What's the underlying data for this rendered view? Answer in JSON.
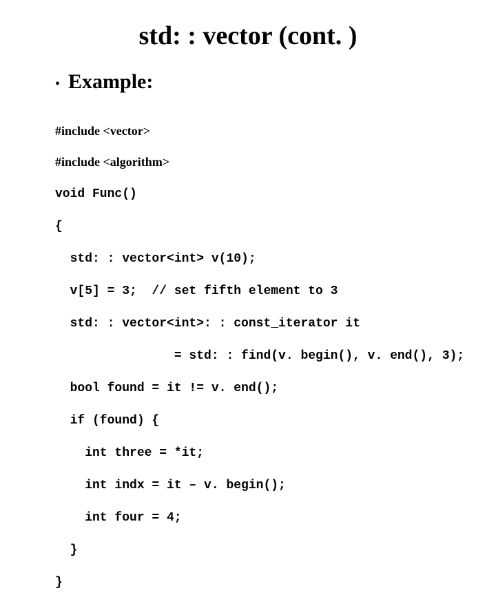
{
  "slide": {
    "title": "std: : vector (cont. )",
    "bullet": "Example:",
    "code": {
      "l1": "#include <vector>",
      "l2": "#include <algorithm>",
      "l3": "void Func()",
      "l4": "{",
      "l5": "  std: : vector<int> v(10);",
      "l6": "  v[5] = 3;  // set fifth element to 3",
      "l7": "  std: : vector<int>: : const_iterator it",
      "l8": "                = std: : find(v. begin(), v. end(), 3);",
      "l9": "  bool found = it != v. end();",
      "l10": "  if (found) {",
      "l11": "    int three = *it;",
      "l12": "    int indx = it – v. begin();",
      "l13": "    int four = 4;",
      "l14": "  }",
      "l15": "}"
    }
  }
}
